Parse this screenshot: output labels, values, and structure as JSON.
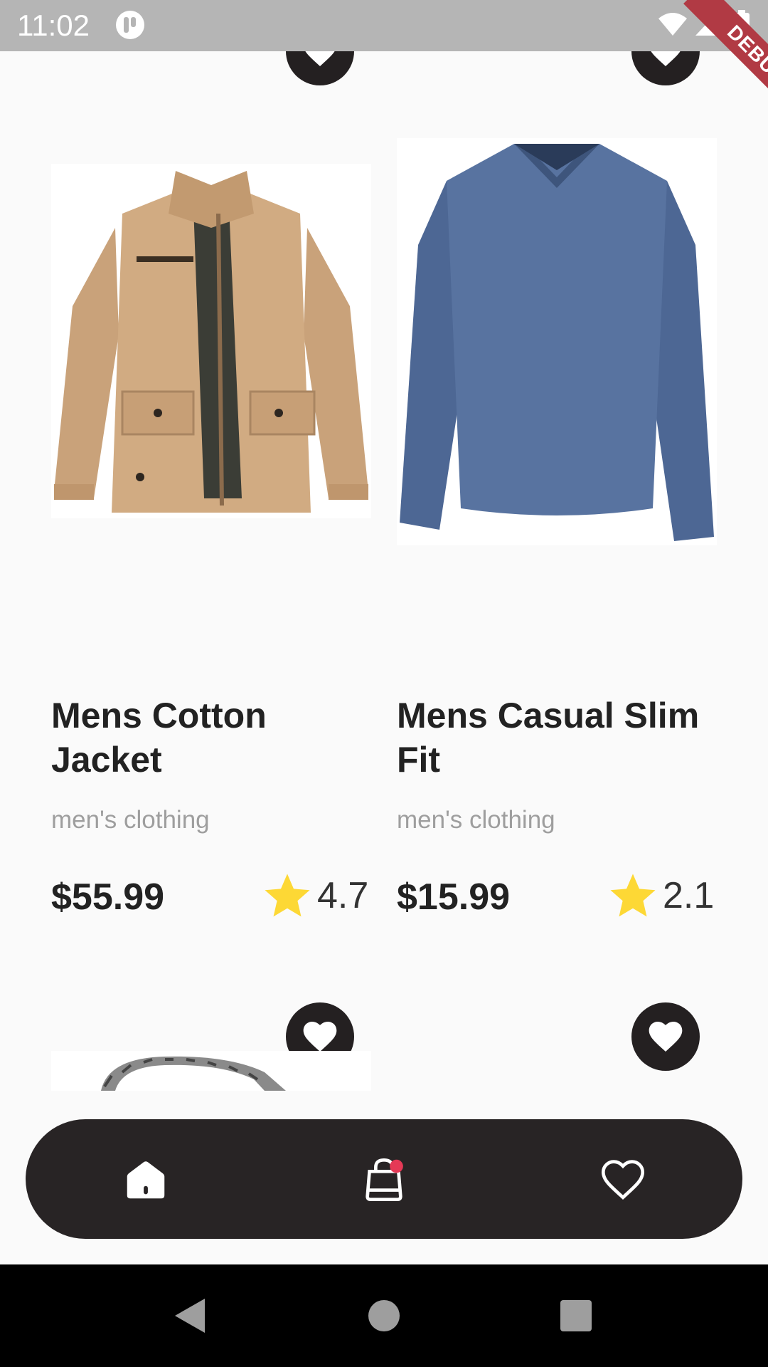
{
  "status_bar": {
    "time": "11:02"
  },
  "debug_banner": {
    "label": "DEBUG"
  },
  "products": [
    {
      "title": "Mens Cotton Jacket",
      "category": "men's clothing",
      "price": "$55.99",
      "rating": "4.7"
    },
    {
      "title": "Mens Casual Slim Fit",
      "category": "men's clothing",
      "price": "$15.99",
      "rating": "2.1"
    }
  ],
  "icons": {
    "favorite": "heart-icon",
    "rating": "star-icon",
    "home": "home-icon",
    "cart": "shopping-bag-icon",
    "favorites_tab": "heart-outline-icon"
  },
  "colors": {
    "accent_dark": "#242021",
    "star": "#FDD835",
    "cart_badge": "#E53956",
    "debug_ribbon": "#B13A44"
  }
}
